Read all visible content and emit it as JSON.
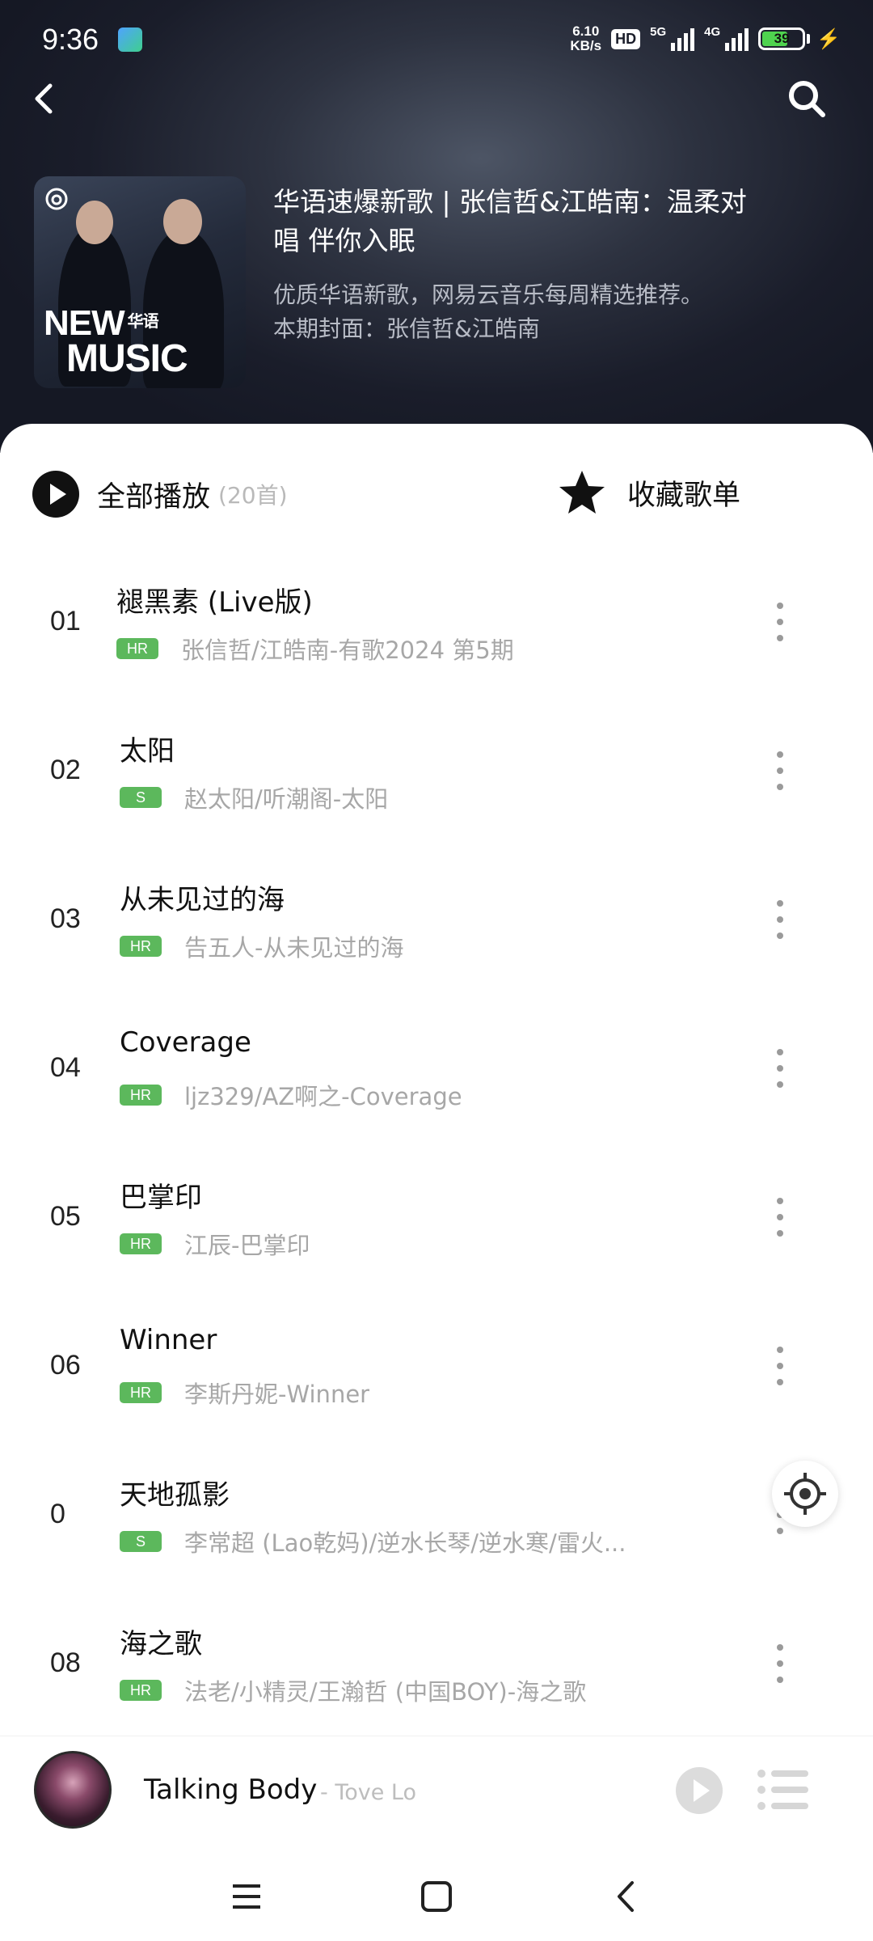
{
  "status_bar": {
    "time": "9:36",
    "speed_top": "6.10",
    "speed_bottom": "KB/s",
    "hd": "HD",
    "signal1": "5G",
    "signal2": "4G",
    "battery": "39"
  },
  "playlist": {
    "title": "华语速爆新歌 | 张信哲&江皓南：温柔对唱 伴你入眠",
    "description": "优质华语新歌，网易云音乐每周精选推荐。",
    "cover_note": "本期封面：张信哲&江皓南",
    "cover_text_line1": "NEW",
    "cover_text_tag": "华语",
    "cover_text_line2": "MUSIC"
  },
  "actions": {
    "play_all_label": "全部播放",
    "play_all_count": "(20首)",
    "collect_label": "收藏歌单"
  },
  "songs": [
    {
      "num": "01",
      "title": "褪黑素 (Live版)",
      "badge": "HR",
      "artist": "张信哲/江皓南-有歌2024 第5期"
    },
    {
      "num": "02",
      "title": "太阳",
      "badge": "S",
      "artist": "赵太阳/听潮阁-太阳"
    },
    {
      "num": "03",
      "title": "从未见过的海",
      "badge": "HR",
      "artist": "告五人-从未见过的海"
    },
    {
      "num": "04",
      "title": "Coverage",
      "badge": "HR",
      "artist": "ljz329/AZ啊之-Coverage"
    },
    {
      "num": "05",
      "title": "巴掌印",
      "badge": "HR",
      "artist": "江辰-巴掌印"
    },
    {
      "num": "06",
      "title": "Winner",
      "badge": "HR",
      "artist": "李斯丹妮-Winner"
    },
    {
      "num": "0",
      "title": "天地孤影",
      "badge": "S",
      "artist": "李常超 (Lao乾妈)/逆水长琴/逆水寒/雷火..."
    },
    {
      "num": "08",
      "title": "海之歌",
      "badge": "HR",
      "artist": "法老/小精灵/王瀚哲 (中国BOY)-海之歌"
    }
  ],
  "mini_player": {
    "title": "Talking Body",
    "artist": " - Tove Lo"
  },
  "colors": {
    "badge_green": "#5cb85c",
    "header_dark": "#1a1d2a"
  }
}
